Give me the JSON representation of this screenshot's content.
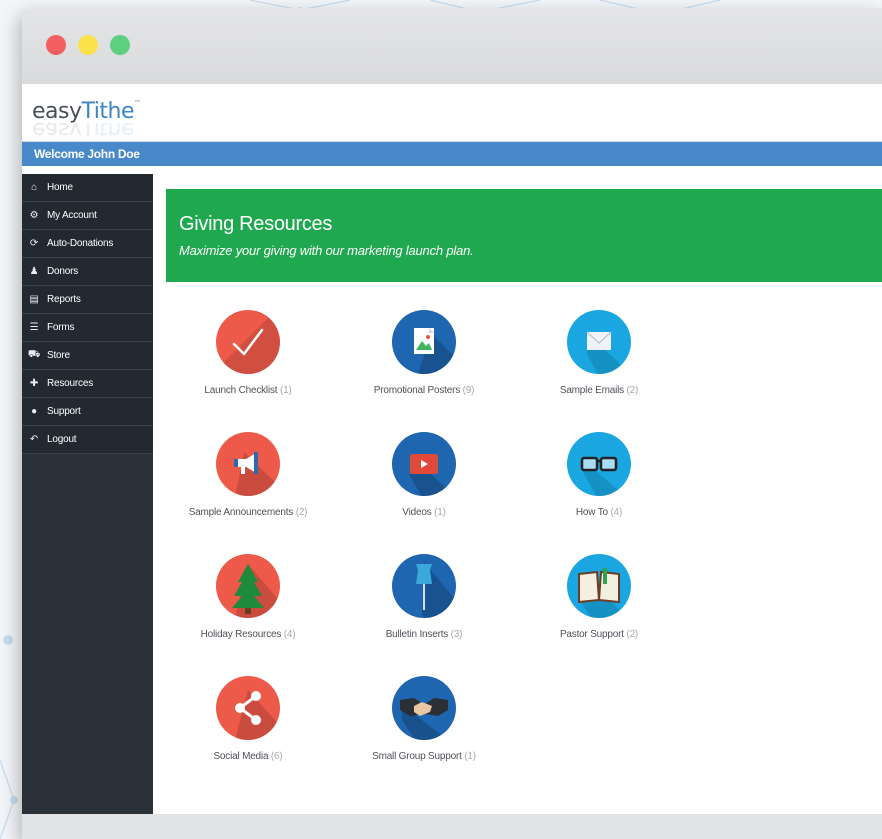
{
  "brand": {
    "part1": "easy",
    "part2": "Tithe",
    "tm": "™"
  },
  "welcome": "Welcome John Doe",
  "sidebar": {
    "items": [
      {
        "label": "Home",
        "icon": "home-icon",
        "glyph": "⌂"
      },
      {
        "label": "My Account",
        "icon": "gear-icon",
        "glyph": "⚙"
      },
      {
        "label": "Auto-Donations",
        "icon": "refresh-icon",
        "glyph": "⟳"
      },
      {
        "label": "Donors",
        "icon": "users-icon",
        "glyph": "♟"
      },
      {
        "label": "Reports",
        "icon": "report-icon",
        "glyph": "▤"
      },
      {
        "label": "Forms",
        "icon": "list-icon",
        "glyph": "☰"
      },
      {
        "label": "Store",
        "icon": "cart-icon",
        "glyph": "⛟"
      },
      {
        "label": "Resources",
        "icon": "gift-icon",
        "glyph": "✚"
      },
      {
        "label": "Support",
        "icon": "support-icon",
        "glyph": "●"
      },
      {
        "label": "Logout",
        "icon": "logout-icon",
        "glyph": "↶"
      }
    ]
  },
  "banner": {
    "title": "Giving Resources",
    "subtitle": "Maximize your giving with our marketing launch plan."
  },
  "resources": [
    {
      "label": "Launch Checklist",
      "count": "(1)",
      "icon": "checkmark-icon",
      "color": "#ed5a4a"
    },
    {
      "label": "Promotional Posters",
      "count": "(9)",
      "icon": "poster-icon",
      "color": "#1e66b0"
    },
    {
      "label": "Sample Emails",
      "count": "(2)",
      "icon": "envelope-icon",
      "color": "#1aa6e0"
    },
    {
      "label": "Sample Announcements",
      "count": "(2)",
      "icon": "megaphone-icon",
      "color": "#ed5a4a"
    },
    {
      "label": "Videos",
      "count": "(1)",
      "icon": "video-icon",
      "color": "#1e66b0"
    },
    {
      "label": "How To",
      "count": "(4)",
      "icon": "glasses-icon",
      "color": "#1aa6e0"
    },
    {
      "label": "Holiday Resources",
      "count": "(4)",
      "icon": "tree-icon",
      "color": "#ed5a4a"
    },
    {
      "label": "Bulletin Inserts",
      "count": "(3)",
      "icon": "pushpin-icon",
      "color": "#1e66b0"
    },
    {
      "label": "Pastor Support",
      "count": "(2)",
      "icon": "book-icon",
      "color": "#1aa6e0"
    },
    {
      "label": "Social Media",
      "count": "(6)",
      "icon": "share-icon",
      "color": "#ed5a4a"
    },
    {
      "label": "Small Group Support",
      "count": "(1)",
      "icon": "handshake-icon",
      "color": "#1e66b0"
    }
  ]
}
